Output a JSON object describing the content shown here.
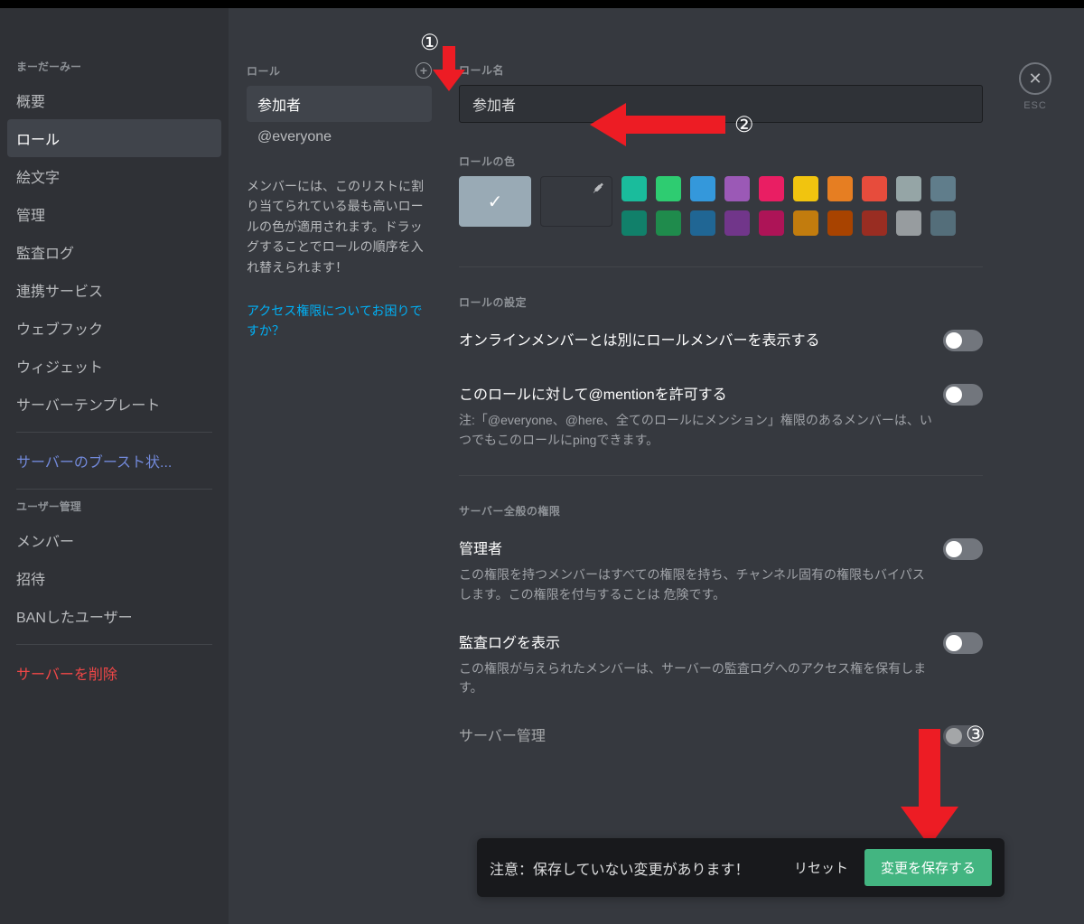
{
  "sidebar": {
    "server_name": "まーだーみー",
    "items_top": [
      "概要",
      "ロール",
      "絵文字",
      "管理",
      "監査ログ",
      "連携サービス",
      "ウェブフック",
      "ウィジェット",
      "サーバーテンプレート"
    ],
    "boost": "サーバーのブースト状...",
    "user_mgmt_header": "ユーザー管理",
    "items_users": [
      "メンバー",
      "招待",
      "BANしたユーザー"
    ],
    "delete": "サーバーを削除"
  },
  "roles_col": {
    "header": "ロール",
    "items": [
      "参加者",
      "@everyone"
    ],
    "help": "メンバーには、このリストに割り当てられている最も高いロールの色が適用されます。ドラッグすることでロールの順序を入れ替えられます！",
    "link": "アクセス権限についてお困りですか？"
  },
  "detail": {
    "name_label": "ロール名",
    "name_value": "参加者",
    "color_label": "ロールの色",
    "colors_row1": [
      "#1abc9c",
      "#2ecc71",
      "#3498db",
      "#9b59b6",
      "#e91e63",
      "#f1c40f",
      "#e67e22",
      "#e74c3c",
      "#95a5a6",
      "#607d8b"
    ],
    "colors_row2": [
      "#11806a",
      "#1f8b4c",
      "#206694",
      "#71368a",
      "#ad1457",
      "#c27c0e",
      "#a84300",
      "#992d22",
      "#979c9f",
      "#546e7a"
    ],
    "settings_header": "ロールの設定",
    "perm1_title": "オンラインメンバーとは別にロールメンバーを表示する",
    "perm2_title": "このロールに対して@mentionを許可する",
    "perm2_desc": "注:「@everyone、@here、全てのロールにメンション」権限のあるメンバーは、いつでもこのロールにpingできます。",
    "server_perms_header": "サーバー全般の権限",
    "perm3_title": "管理者",
    "perm3_desc": "この権限を持つメンバーはすべての権限を持ち、チャンネル固有の権限もバイパスします。この権限を付与することは 危険です。",
    "perm4_title": "監査ログを表示",
    "perm4_desc": "この権限が与えられたメンバーは、サーバーの監査ログへのアクセス権を保有します。",
    "perm5_title": "サーバー管理"
  },
  "savebar": {
    "text": "注意：保存していない変更があります！",
    "reset": "リセット",
    "save": "変更を保存する"
  },
  "esc": "ESC",
  "annotations": {
    "n1": "①",
    "n2": "②",
    "n3": "③"
  }
}
